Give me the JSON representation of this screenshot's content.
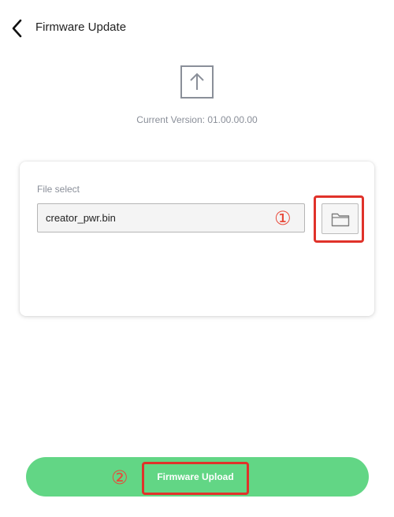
{
  "header": {
    "title": "Firmware Update",
    "back_icon": "chevron-left-icon"
  },
  "status": {
    "upload_icon": "upload-arrow-icon",
    "current_version": "Current Version: 01.00.00.00"
  },
  "file_select": {
    "label": "File select",
    "value": "creator_pwr.bin",
    "browse_icon": "folder-icon",
    "annotation": "①"
  },
  "actions": {
    "upload_label": "Firmware Upload",
    "annotation": "②"
  },
  "colors": {
    "accent_green": "#62d685",
    "annotation_red": "#e0322a",
    "muted_text": "#8a8f99"
  }
}
